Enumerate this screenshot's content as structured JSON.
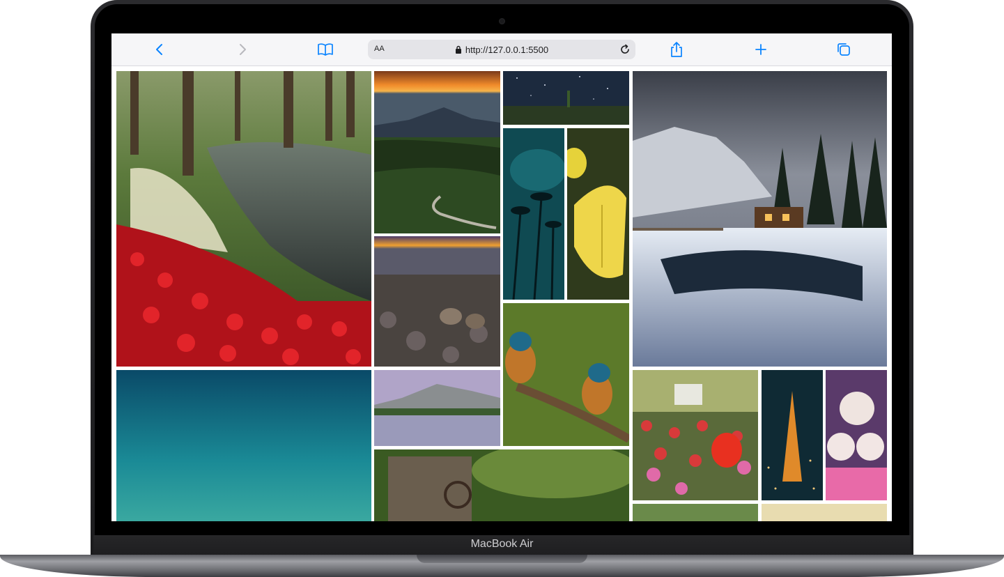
{
  "device": {
    "label": "MacBook Air"
  },
  "browser": {
    "reader_label": "AA",
    "url": "http://127.0.0.1:5500",
    "icons": {
      "back": "chevron-left-icon",
      "forward": "chevron-right-icon",
      "bookmarks": "book-icon",
      "lock": "lock-icon",
      "reload": "reload-icon",
      "share": "share-icon",
      "new_tab": "plus-icon",
      "tabs": "tabs-icon"
    },
    "accent": "#0a84ff"
  },
  "gallery": {
    "photos": [
      {
        "subject": "red tulips and canal in park"
      },
      {
        "subject": "mountain at sunset with winding path"
      },
      {
        "subject": "starry night sky"
      },
      {
        "subject": "teal palm silhouettes"
      },
      {
        "subject": "yellow butterfly"
      },
      {
        "subject": "snowy cabin by mountain lake"
      },
      {
        "subject": "bighorn sheep at dusk"
      },
      {
        "subject": "kingfishers on branch"
      },
      {
        "subject": "mountain lake reflection"
      },
      {
        "subject": "teal gradient"
      },
      {
        "subject": "stone mill in forest"
      },
      {
        "subject": "tulip field with gazebo"
      },
      {
        "subject": "tokyo tower at night"
      },
      {
        "subject": "kittens in pink basket"
      },
      {
        "subject": "green forest"
      },
      {
        "subject": "sunlit trees"
      }
    ]
  }
}
